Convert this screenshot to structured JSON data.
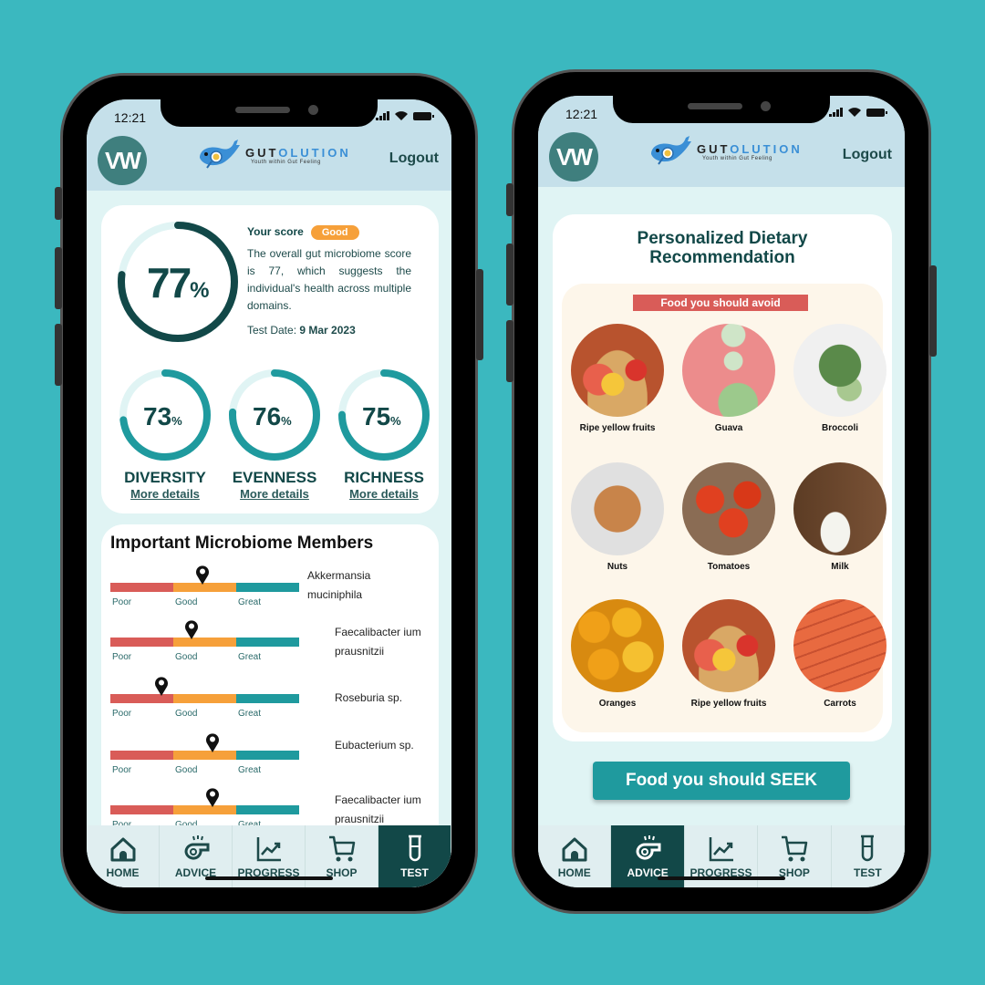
{
  "colors": {
    "background": "#3bb8bf",
    "dark_teal": "#124848",
    "teal": "#1f9a9e",
    "poor": "#d95c58",
    "good": "#f6a03a",
    "great": "#1f9a9e"
  },
  "status_bar": {
    "time": "12:21"
  },
  "header": {
    "avatar_initials": "VW",
    "brand_part1": "GUT",
    "brand_part2": "OLUTION",
    "tagline": "Youth within Gut Feeling",
    "logout_label": "Logout"
  },
  "score_screen": {
    "overall": {
      "value": 77,
      "value_label": "77",
      "percent_sign": "%",
      "title": "Your score",
      "badge": "Good",
      "description": "The overall gut microbiome score is 77, which suggests the individual's health across multiple domains.",
      "test_date_label": "Test Date:",
      "test_date": "9 Mar 2023"
    },
    "metrics": [
      {
        "name": "DIVERSITY",
        "value": 73,
        "value_label": "73",
        "percent_sign": "%",
        "link": "More details"
      },
      {
        "name": "EVENNESS",
        "value": 76,
        "value_label": "76",
        "percent_sign": "%",
        "link": "More details"
      },
      {
        "name": "RICHNESS",
        "value": 75,
        "value_label": "75",
        "percent_sign": "%",
        "link": "More details"
      }
    ],
    "members_title": "Important Microbiome Members",
    "scale_labels": [
      "Poor",
      "Good",
      "Great"
    ],
    "members": [
      {
        "name": "Akkermansia muciniphila",
        "position": 0.49
      },
      {
        "name": "Faecalibacter ium prausnitzii",
        "position": 0.43
      },
      {
        "name": "Roseburia sp.",
        "position": 0.27
      },
      {
        "name": "Eubacterium sp.",
        "position": 0.54
      },
      {
        "name": "Faecalibacter ium prausnitzii",
        "position": 0.54
      }
    ]
  },
  "diet_screen": {
    "title_line1": "Personalized Dietary",
    "title_line2": "Recommendation",
    "avoid_banner": "Food you should avoid",
    "foods": [
      {
        "name": "Ripe yellow fruits",
        "icon": "fruit-bowl-photo"
      },
      {
        "name": "Guava",
        "icon": "guava-photo"
      },
      {
        "name": "Broccoli",
        "icon": "broccoli-photo"
      },
      {
        "name": "Nuts",
        "icon": "nuts-photo"
      },
      {
        "name": "Tomatoes",
        "icon": "tomatoes-photo"
      },
      {
        "name": "Milk",
        "icon": "milk-photo"
      },
      {
        "name": "Oranges",
        "icon": "oranges-photo"
      },
      {
        "name": "Ripe yellow fruits",
        "icon": "fruit-bowl-photo"
      },
      {
        "name": "Carrots",
        "icon": "carrots-photo"
      }
    ],
    "seek_button": "Food you should SEEK"
  },
  "nav": {
    "items": [
      {
        "label": "HOME",
        "icon": "home-icon"
      },
      {
        "label": "ADVICE",
        "icon": "whistle-icon"
      },
      {
        "label": "PROGRESS",
        "icon": "chart-icon"
      },
      {
        "label": "SHOP",
        "icon": "cart-icon"
      },
      {
        "label": "TEST",
        "icon": "test-tube-icon"
      }
    ],
    "left_active": "TEST",
    "right_active": "ADVICE"
  }
}
